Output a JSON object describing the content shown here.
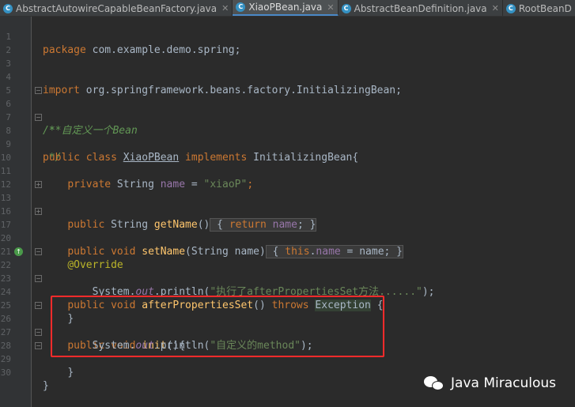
{
  "tabs": [
    {
      "label": "AbstractAutowireCapableBeanFactory.java",
      "active": false,
      "closable": true
    },
    {
      "label": "XiaoPBean.java",
      "active": true,
      "closable": true
    },
    {
      "label": "AbstractBeanDefinition.java",
      "active": false,
      "closable": true
    },
    {
      "label": "RootBeanD",
      "active": false,
      "closable": false
    }
  ],
  "line_numbers": [
    "1",
    "2",
    "3",
    "4",
    "5",
    "6",
    "7",
    "8",
    "9",
    "10",
    "11",
    "12",
    "13",
    "16",
    "17",
    "20",
    "21",
    "22",
    "23",
    "24",
    "25",
    "26",
    "27",
    "28",
    "29",
    "30"
  ],
  "code": {
    "l1": [
      "package",
      " com.example.demo.spring;"
    ],
    "l4": [
      "import",
      " org.springframework.beans.factory.InitializingBean;"
    ],
    "l6": "/**",
    "l7": " * 自定义一个Bean",
    "l8": " */",
    "l9": [
      "public",
      " ",
      "class",
      " ",
      "XiaoPBean",
      " ",
      "implements",
      " InitializingBean{"
    ],
    "l11": [
      "private",
      " String ",
      "name",
      " = ",
      "\"xiaoP\"",
      ";"
    ],
    "l13": [
      "public",
      " String ",
      "getName",
      "()",
      " { ",
      "return",
      " ",
      "name",
      "; }"
    ],
    "l17": [
      "public",
      " ",
      "void",
      " ",
      "setName",
      "(String name)",
      " { ",
      "this",
      ".",
      "name",
      " = name; }"
    ],
    "l21": "@Override",
    "l22": [
      "public",
      " ",
      "void",
      " ",
      "afterPropertiesSet",
      "() ",
      "throws",
      " ",
      "Exception",
      " {"
    ],
    "l23": [
      "System.",
      "out",
      ".println(",
      "\"执行了afterPropertiesSet方法......\"",
      ");"
    ],
    "l24": "}",
    "l26": [
      "public",
      " ",
      "void",
      " ",
      "init",
      "(){"
    ],
    "l27": [
      "System.",
      "out",
      ".println(",
      "\"自定义的method\"",
      ");"
    ],
    "l28": "}",
    "l29": "}"
  },
  "watermark": {
    "text": "Java Miraculous",
    "icon": "wechat-icon"
  },
  "colors": {
    "background": "#2b2b2b",
    "keyword": "#cc7832",
    "string": "#6a8759",
    "field": "#9876aa",
    "highlight": "#ff2b2b"
  }
}
